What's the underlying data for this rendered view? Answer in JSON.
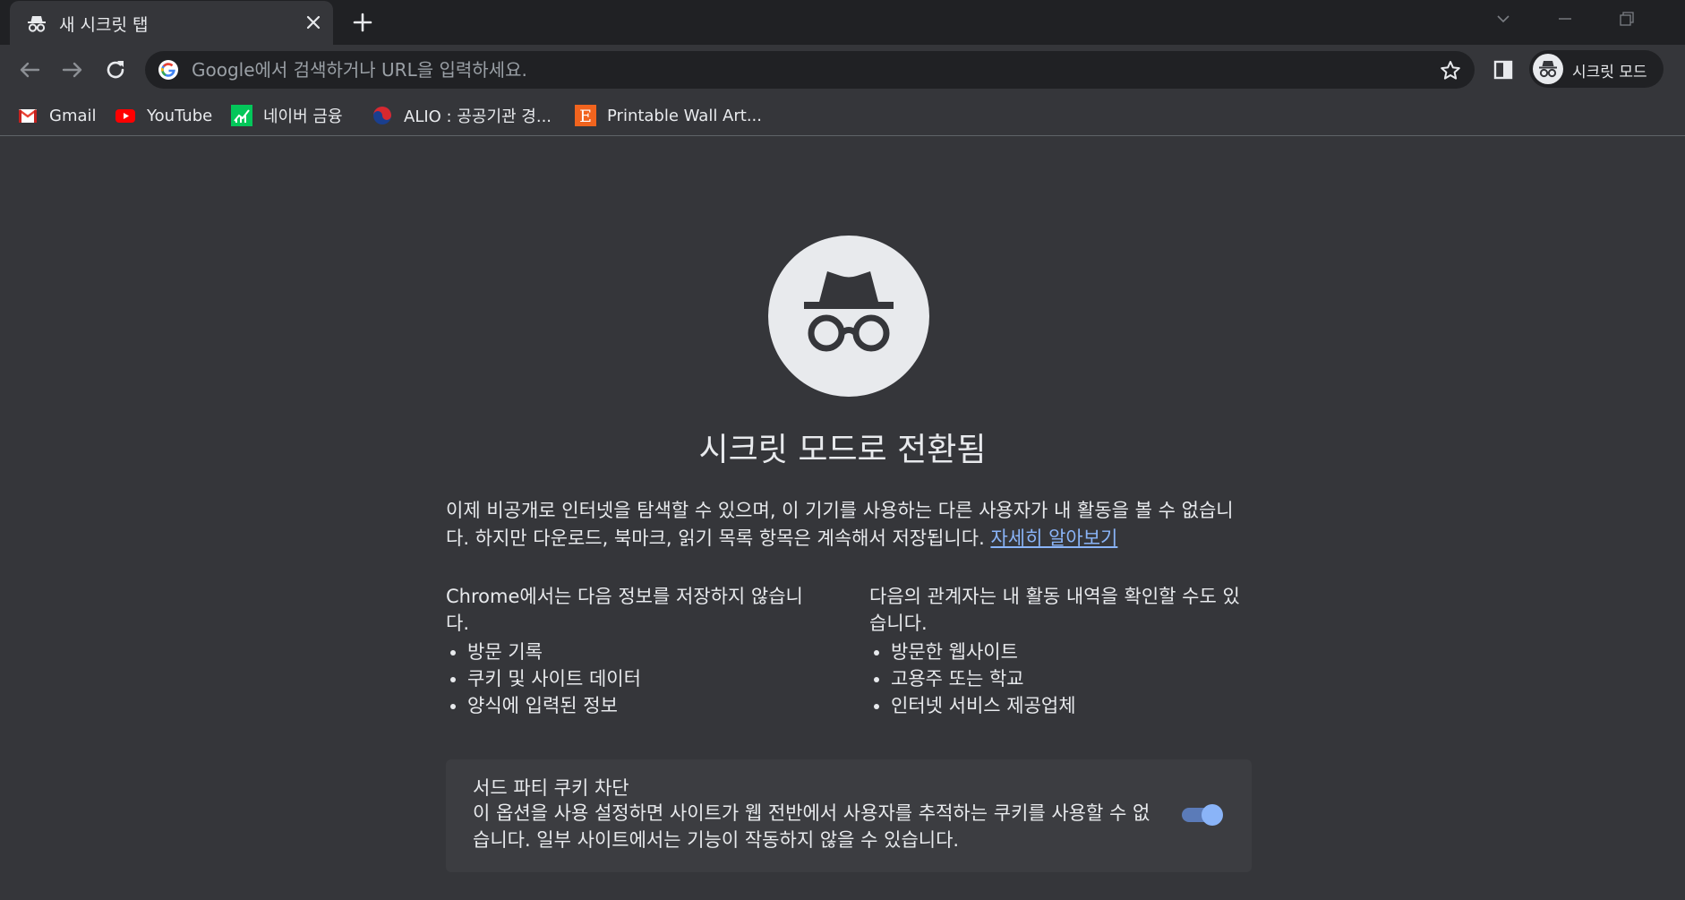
{
  "tab": {
    "title": "새 시크릿 탭"
  },
  "omnibox": {
    "placeholder": "Google에서 검색하거나 URL을 입력하세요."
  },
  "profile": {
    "label": "시크릿 모드"
  },
  "bookmarks": [
    {
      "label": "Gmail",
      "icon": "gmail-icon"
    },
    {
      "label": "YouTube",
      "icon": "youtube-icon"
    },
    {
      "label": "네이버 금융",
      "icon": "naver-finance-icon"
    },
    {
      "label": "ALIO : 공공기관 경...",
      "icon": "alio-icon"
    },
    {
      "label": "Printable Wall Art...",
      "icon": "etsy-icon"
    }
  ],
  "content": {
    "headline": "시크릿 모드로 전환됨",
    "intro_text": "이제 비공개로 인터넷을 탐색할 수 있으며, 이 기기를 사용하는 다른 사용자가 내 활동을 볼 수 없습니다. 하지만 다운로드, 북마크, 읽기 목록 항목은 계속해서 저장됩니다.",
    "learn_more": "자세히 알아보기",
    "not_saved": {
      "title": "Chrome에서는 다음 정보를 저장하지 않습니다.",
      "items": [
        "방문 기록",
        "쿠키 및 사이트 데이터",
        "양식에 입력된 정보"
      ]
    },
    "visible_to": {
      "title": "다음의 관계자는 내 활동 내역을 확인할 수도 있습니다.",
      "items": [
        "방문한 웹사이트",
        "고용주 또는 학교",
        "인터넷 서비스 제공업체"
      ]
    },
    "cookie_block": {
      "title": "서드 파티 쿠키 차단",
      "description": "이 옵션을 사용 설정하면 사이트가 웹 전반에서 사용자를 추적하는 쿠키를 사용할 수 없습니다. 일부 사이트에서는 기능이 작동하지 않을 수 있습니다.",
      "enabled": true
    }
  },
  "colors": {
    "frame": "#202124",
    "toolbar": "#35363a",
    "text": "#e8eaed",
    "link": "#8ab4f8",
    "card": "#3c3d41"
  }
}
